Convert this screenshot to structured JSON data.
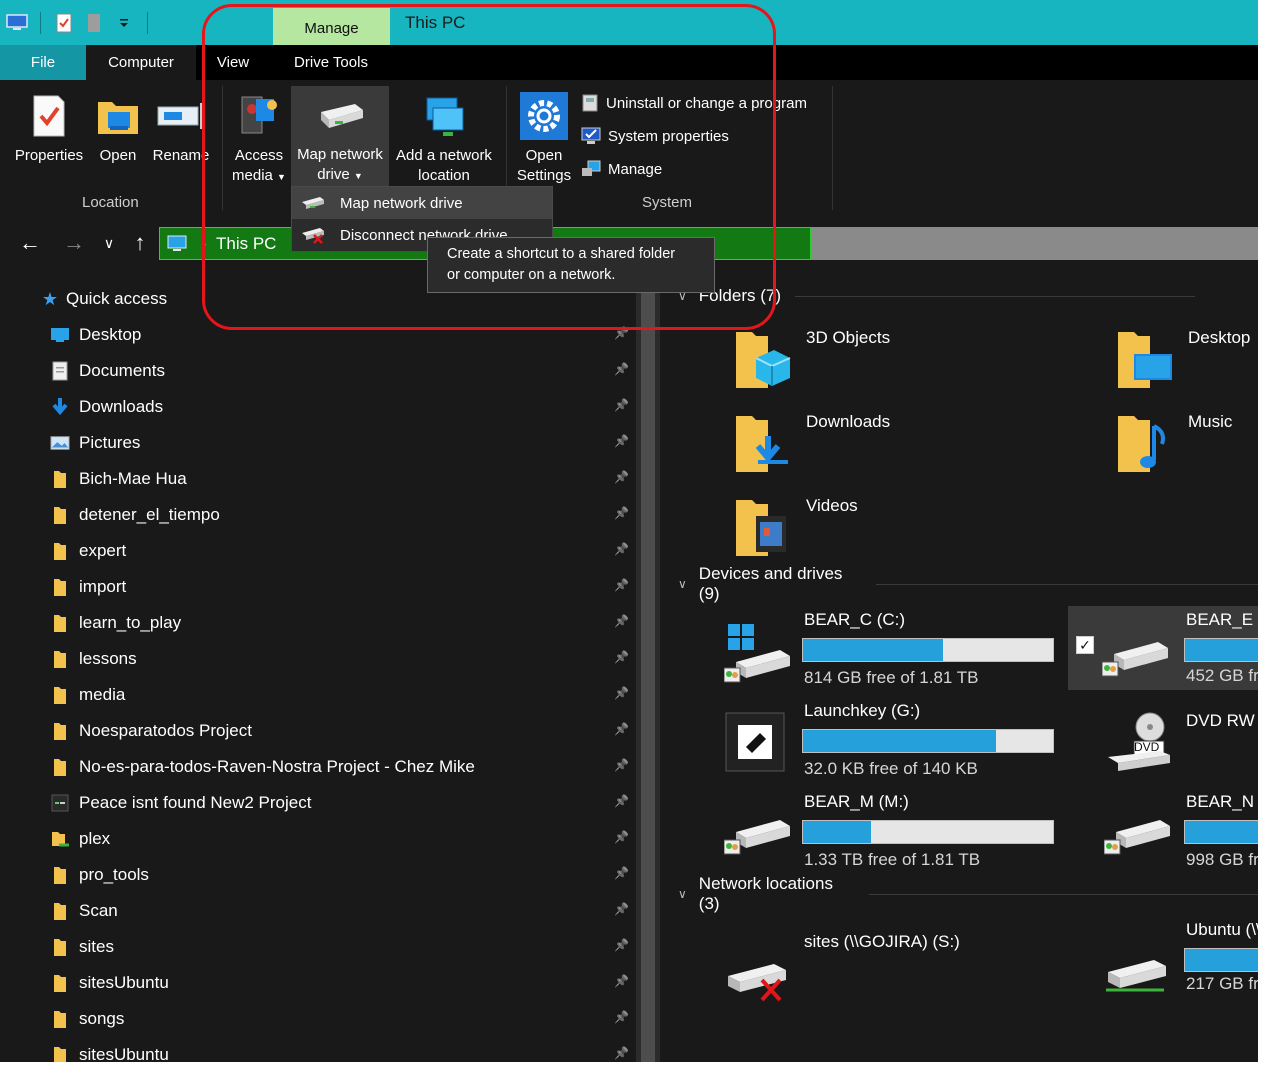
{
  "window": {
    "context_tab": "Manage",
    "title": "This PC"
  },
  "tabs": {
    "file": "File",
    "computer": "Computer",
    "view": "View",
    "drive_tools": "Drive Tools"
  },
  "ribbon": {
    "properties": "Properties",
    "open": "Open",
    "rename": "Rename",
    "access_media_1": "Access",
    "access_media_2": "media",
    "map_drive_1": "Map network",
    "map_drive_2": "drive",
    "add_location_1": "Add a network",
    "add_location_2": "location",
    "open_settings_1": "Open",
    "open_settings_2": "Settings",
    "uninstall": "Uninstall or change a program",
    "system_properties": "System properties",
    "manage": "Manage",
    "group_location": "Location",
    "group_system": "System"
  },
  "dropdown": {
    "map": "Map network drive",
    "disconnect": "Disconnect network drive",
    "tooltip_1": "Create a shortcut to a shared folder",
    "tooltip_2": "or computer on a network."
  },
  "address": {
    "path": "This PC"
  },
  "tree": {
    "quick_access": "Quick access",
    "items": [
      "Desktop",
      "Documents",
      "Downloads",
      "Pictures",
      "Bich-Mae Hua",
      "detener_el_tiempo",
      "expert",
      "import",
      "learn_to_play",
      "lessons",
      "media",
      "Noesparatodos Project",
      "No-es-para-todos-Raven-Nostra Project - Chez Mike",
      "Peace isnt found New2 Project",
      "plex",
      "pro_tools",
      "Scan",
      "sites",
      "sitesUbuntu",
      "songs",
      "sitesUbuntu"
    ]
  },
  "content": {
    "folders_header": "Folders (7)",
    "folders": [
      "3D Objects",
      "Desktop",
      "Downloads",
      "Music",
      "Videos"
    ],
    "devices_header": "Devices and drives (9)",
    "drives": {
      "c_name": "BEAR_C (C:)",
      "c_free": "814 GB free of 1.81 TB",
      "c_used": 0.56,
      "e_name": "BEAR_E (E",
      "e_free": "452 GB fre",
      "e_used": 0.76,
      "g_name": "Launchkey (G:)",
      "g_free": "32.0 KB free of 140 KB",
      "g_used": 0.77,
      "dvd_name": "DVD RW",
      "m_name": "BEAR_M (M:)",
      "m_free": "1.33 TB free of 1.81 TB",
      "m_used": 0.27,
      "n_name": "BEAR_N (N",
      "n_free": "998 GB fr",
      "n_used": 0.45
    },
    "network_header": "Network locations (3)",
    "network": {
      "sites_name": "sites (\\\\GOJIRA) (S:)",
      "ubuntu_name": "Ubuntu (\\\\",
      "ubuntu_free": "217 GB fre",
      "ubuntu_used": 0.88
    }
  },
  "colors": {
    "titlebar": "#17b5c0",
    "manage_tab": "#b5e7a0",
    "address": "#137a13",
    "bar_fill": "#26a0da",
    "highlight": "#e5161b"
  }
}
